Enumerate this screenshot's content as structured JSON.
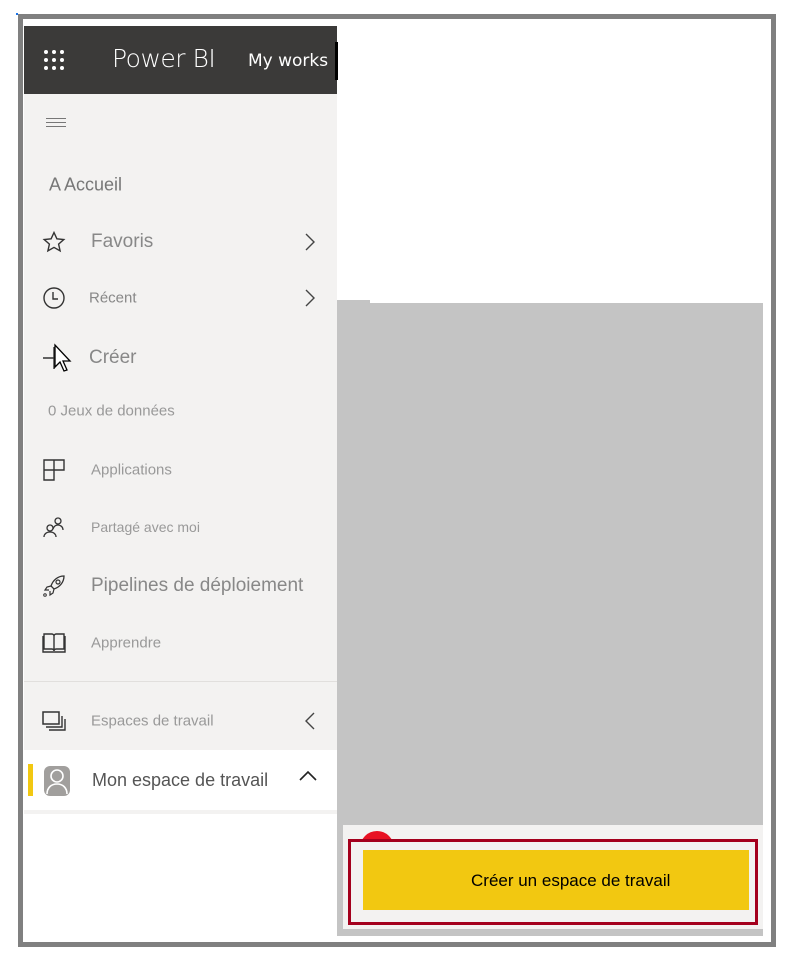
{
  "header": {
    "app_name": "Power BI",
    "workspace_label": "My works",
    "waffle_icon": "app-launcher-icon"
  },
  "sidebar": {
    "menu_icon": "hamburger-icon",
    "home": {
      "label": "A Accueil"
    },
    "items": [
      {
        "label": "Favoris",
        "icon": "star-icon",
        "chevron": "chevron-right-icon"
      },
      {
        "label": "Récent",
        "icon": "clock-icon",
        "chevron": "chevron-right-icon"
      },
      {
        "label": "Créer",
        "icon": "plus-icon"
      },
      {
        "label": "0 Jeux de données"
      },
      {
        "label": "Applications",
        "icon": "apps-icon"
      },
      {
        "label": "Partagé avec moi",
        "icon": "shared-users-icon"
      },
      {
        "label": "Pipelines de déploiement",
        "icon": "rocket-icon"
      },
      {
        "label": "Apprendre",
        "icon": "book-icon"
      },
      {
        "label": "Espaces de travail",
        "icon": "workspaces-icon",
        "chevron": "chevron-left-icon"
      }
    ],
    "my_workspace": {
      "label": "Mon espace de travail",
      "icon": "person-icon",
      "chevron": "chevron-up-icon"
    }
  },
  "flyout": {
    "create_workspace_button": "Créer un espace de travail"
  },
  "colors": {
    "topbar": "#3b3a39",
    "sidebar": "#f3f2f1",
    "accent_yellow": "#f2c811",
    "highlight_border": "#a4001d",
    "overlay_gray": "#c4c4c4",
    "frame": "#808080"
  }
}
